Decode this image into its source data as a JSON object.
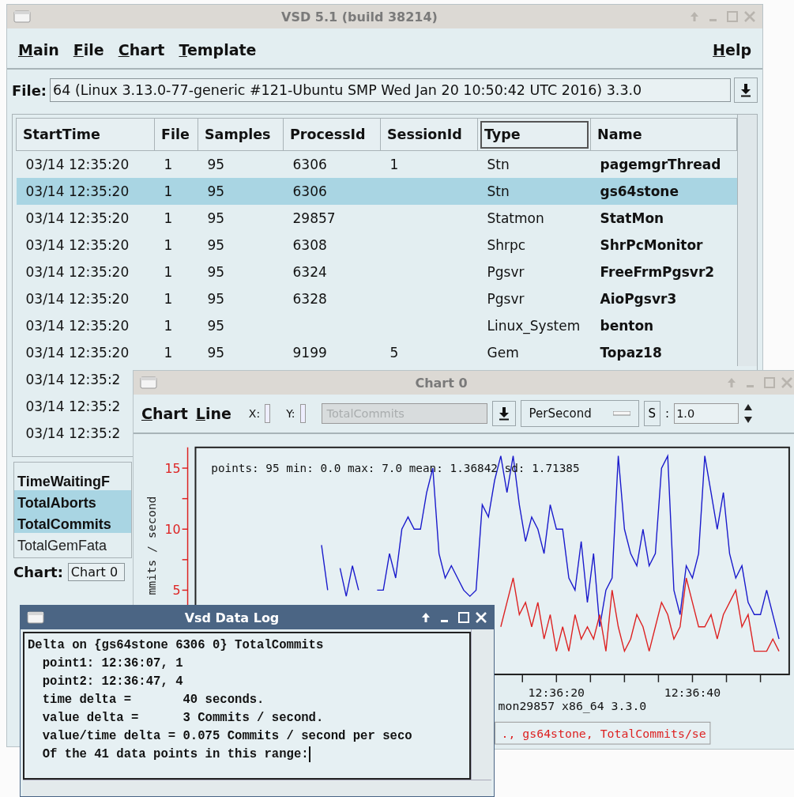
{
  "main_window": {
    "title": "VSD 5.1 (build 38214)",
    "active": false,
    "menus": [
      {
        "label": "Main"
      },
      {
        "label": "File"
      },
      {
        "label": "Chart"
      },
      {
        "label": "Template"
      }
    ],
    "help_menu": {
      "label": "Help"
    },
    "file_label": "File:",
    "file_value": "64 (Linux 3.13.0-77-generic #121-Ubuntu SMP Wed Jan 20 10:50:42 UTC 2016) 3.3.0",
    "table": {
      "columns": [
        {
          "label": "StartTime",
          "sorted": false
        },
        {
          "label": "File",
          "sorted": false
        },
        {
          "label": "Samples",
          "sorted": false
        },
        {
          "label": "ProcessId",
          "sorted": false
        },
        {
          "label": "SessionId",
          "sorted": false
        },
        {
          "label": "Type",
          "sorted": true
        },
        {
          "label": "Name",
          "sorted": false
        }
      ],
      "rows": [
        {
          "cells": [
            "03/14 12:35:20",
            "1",
            "95",
            "6306",
            "1",
            "Stn",
            "pagemgrThread"
          ],
          "selected": false
        },
        {
          "cells": [
            "03/14 12:35:20",
            "1",
            "95",
            "6306",
            "",
            "Stn",
            "gs64stone"
          ],
          "selected": true
        },
        {
          "cells": [
            "03/14 12:35:20",
            "1",
            "95",
            "29857",
            "",
            "Statmon",
            "StatMon"
          ],
          "selected": false
        },
        {
          "cells": [
            "03/14 12:35:20",
            "1",
            "95",
            "6308",
            "",
            "Shrpc",
            "ShrPcMonitor"
          ],
          "selected": false
        },
        {
          "cells": [
            "03/14 12:35:20",
            "1",
            "95",
            "6324",
            "",
            "Pgsvr",
            "FreeFrmPgsvr2"
          ],
          "selected": false
        },
        {
          "cells": [
            "03/14 12:35:20",
            "1",
            "95",
            "6328",
            "",
            "Pgsvr",
            "AioPgsvr3"
          ],
          "selected": false
        },
        {
          "cells": [
            "03/14 12:35:20",
            "1",
            "95",
            "",
            "",
            "Linux_System",
            "benton"
          ],
          "selected": false
        },
        {
          "cells": [
            "03/14 12:35:20",
            "1",
            "95",
            "9199",
            "5",
            "Gem",
            "Topaz18"
          ],
          "selected": false
        },
        {
          "cells": [
            "03/14 12:35:2"
          ],
          "selected": false
        },
        {
          "cells": [
            "03/14 12:35:2"
          ],
          "selected": false
        },
        {
          "cells": [
            "03/14 12:35:2"
          ],
          "selected": false
        }
      ]
    },
    "stats": [
      {
        "label": "TimeWaitingF",
        "emphasized": true,
        "selected": false
      },
      {
        "label": "TotalAborts",
        "emphasized": true,
        "selected": true
      },
      {
        "label": "TotalCommits",
        "emphasized": true,
        "selected": true
      },
      {
        "label": "TotalGemFata",
        "emphasized": false,
        "selected": false
      }
    ],
    "chart_label": "Chart:",
    "chart_value": "Chart 0"
  },
  "chart_window": {
    "title": "Chart 0",
    "active": false,
    "menus": [
      {
        "label": "Chart"
      },
      {
        "label": "Line"
      }
    ],
    "x_label": "X:",
    "y_label": "Y:",
    "series_field": {
      "value": "TotalCommits",
      "disabled": true
    },
    "mode": "PerSecond",
    "s_button": "S",
    "scale_sep": ":",
    "scale_value": "1.0",
    "stats_text": "points: 95 min: 0.0 max: 7.0 mean: 1.36842 sd: 1.71385",
    "subtitle": "mon29857 x86_64 3.3.0",
    "legend": "., gs64stone, TotalCommits/se",
    "chart_data": {
      "type": "line",
      "ylabel": "mmits / second",
      "categories": [
        null,
        null,
        null,
        null,
        null,
        null,
        null,
        null,
        null,
        null,
        null,
        null,
        null,
        null,
        null,
        null,
        null,
        null,
        null,
        null,
        null,
        null,
        null,
        null,
        null,
        null,
        null,
        null,
        null,
        null,
        null,
        null,
        null,
        null,
        null,
        null,
        null,
        null,
        null,
        null,
        null,
        null,
        null,
        null,
        null,
        null,
        null,
        null,
        null,
        null,
        null,
        null,
        null,
        null,
        null,
        null,
        null,
        null,
        "12:36:20",
        null,
        null,
        null,
        null,
        null,
        null,
        null,
        null,
        null,
        null,
        null,
        null,
        null,
        null,
        null,
        null,
        null,
        null,
        null,
        null,
        null,
        "12:36:40",
        null,
        null,
        null,
        null,
        null,
        null,
        null,
        null,
        null,
        null,
        null,
        null,
        null,
        null
      ],
      "ylim": [
        -1.9,
        16.7
      ],
      "yticks": [
        5,
        10,
        15
      ],
      "series": [
        {
          "color": "#1a1acc",
          "values": [
            null,
            null,
            null,
            null,
            null,
            null,
            null,
            null,
            null,
            null,
            null,
            null,
            null,
            null,
            null,
            null,
            null,
            null,
            null,
            null,
            8.7,
            5,
            null,
            6.8,
            4.5,
            7,
            5,
            null,
            null,
            5,
            5,
            8,
            6,
            10,
            11,
            10,
            10,
            13,
            15,
            8,
            6,
            7,
            6,
            5,
            4.5,
            5,
            12,
            11,
            14,
            16,
            13,
            16,
            12,
            9,
            11,
            10,
            8,
            12,
            10,
            10,
            6,
            5,
            9,
            4,
            8,
            2,
            5,
            6,
            16,
            10,
            8,
            7,
            10,
            7,
            8,
            15,
            16,
            5,
            3,
            7,
            6,
            8,
            16,
            13,
            10,
            13,
            8,
            6,
            7,
            4,
            3,
            3,
            5,
            3,
            1
          ]
        },
        {
          "color": "#dd2222",
          "values": [
            null,
            null,
            null,
            null,
            null,
            null,
            null,
            null,
            null,
            null,
            null,
            null,
            null,
            null,
            null,
            null,
            null,
            null,
            null,
            null,
            null,
            null,
            null,
            null,
            null,
            null,
            null,
            null,
            null,
            null,
            null,
            null,
            null,
            null,
            null,
            null,
            null,
            null,
            null,
            null,
            null,
            null,
            null,
            null,
            null,
            null,
            null,
            null,
            null,
            2,
            4,
            6,
            3,
            4,
            2,
            4,
            1,
            3,
            0,
            2,
            0,
            3,
            1,
            2,
            1,
            3,
            0,
            5,
            2,
            0,
            1,
            3,
            2,
            0,
            2,
            4,
            3,
            1,
            2,
            6,
            4,
            2,
            2,
            3,
            1,
            3,
            4,
            5,
            2,
            3,
            0,
            0,
            0,
            1,
            0
          ]
        }
      ]
    }
  },
  "log_window": {
    "title": "Vsd Data Log",
    "active": true,
    "lines": [
      "Delta on {gs64stone 6306 0} TotalCommits",
      "  point1: 12:36:07, 1",
      "  point2: 12:36:47, 4",
      "  time delta =       40 seconds.",
      "  value delta =      3 Commits / second.",
      "  value/time delta = 0.075 Commits / second per seco",
      "  Of the 41 data points in this range:"
    ]
  }
}
